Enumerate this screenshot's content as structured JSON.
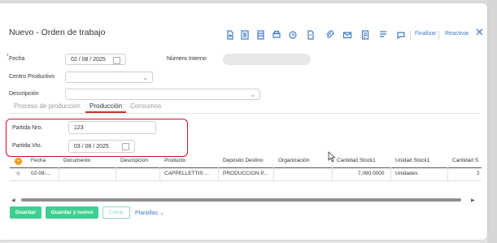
{
  "window": {
    "title": "Nuevo - Orden de trabajo"
  },
  "toolbar": {
    "icons": [
      "new-document-icon",
      "form-icon",
      "sheet-icon",
      "print-icon",
      "history-icon",
      "attachment-icon",
      "clip-icon",
      "email-icon",
      "list-icon",
      "checklist-icon",
      "comment-icon"
    ],
    "finalizar": "Finalizar",
    "reactivar": "Reactivar"
  },
  "form": {
    "fecha_label": "Fecha",
    "required_mark": "*",
    "fecha_value": "02 / 08 / 2025",
    "numero_interno_label": "Número Interno",
    "numero_interno_value": "",
    "centro_productivo_label": "Centro Productivo",
    "centro_productivo_value": "",
    "descripcion_label": "Descripción",
    "descripcion_value": ""
  },
  "tabs": [
    "Proceso de produccion",
    "Producción",
    "Consumos"
  ],
  "active_tab": "Producción",
  "production": {
    "partida_nro_label": "Partida Nro.",
    "partida_nro_value": "123",
    "partida_vto_label": "Partida Vto.",
    "partida_vto_value": "03 / 08 / 2025"
  },
  "grid": {
    "add_icon": "+",
    "columns": [
      "Fecha",
      "Documento",
      "Descripcion",
      "Producto",
      "Depósito Destino",
      "Organización",
      "Cantidad Stock1",
      "Unidad Stock1",
      "Cantidad S"
    ],
    "rows": [
      {
        "fecha": "02-08-...",
        "documento": "",
        "descripcion": "",
        "producto": "CAPPELLETTIS ...",
        "deposito": "PRODUCCION P...",
        "organizacion": "",
        "cantidad": "7,080.0000",
        "unidad": "Unidades",
        "cantidad2": "2"
      }
    ]
  },
  "buttons": {
    "guardar": "Guardar",
    "guardar_nuevo": "Guardar y nuevo",
    "cerrar": "Cerrar",
    "plantillas": "Plantillas ⌄"
  }
}
